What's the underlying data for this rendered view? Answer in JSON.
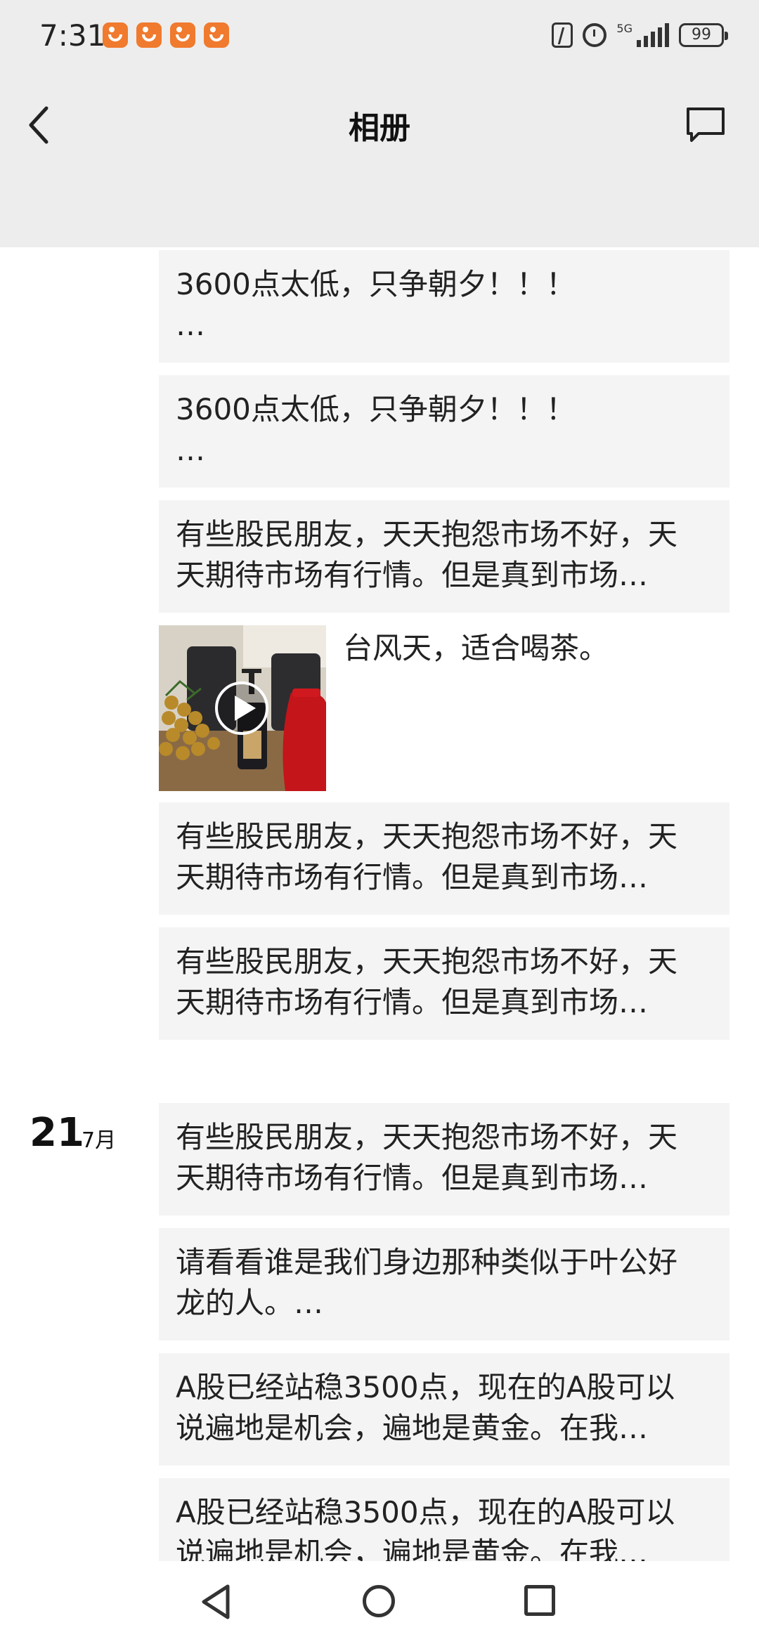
{
  "status_bar": {
    "time": "7:31",
    "notifications": [
      "app-notification-icon",
      "app-notification-icon",
      "app-notification-icon",
      "app-notification-icon"
    ],
    "network": "5G",
    "battery": "99"
  },
  "header": {
    "title": "相册",
    "back_icon": "chevron-left-icon",
    "action_icon": "comment-icon"
  },
  "feed": {
    "posts": [
      {
        "text": "3600点太低，只争朝夕！！！\n…"
      },
      {
        "text": "3600点太低，只争朝夕！！！\n…"
      },
      {
        "text": "有些股民朋友，天天抱怨市场不好，天\n天期待市场有行情。但是真到市场…"
      },
      {
        "type": "video",
        "caption": "台风天，适合喝茶。"
      },
      {
        "text": "有些股民朋友，天天抱怨市场不好，天\n天期待市场有行情。但是真到市场…"
      },
      {
        "text": "有些股民朋友，天天抱怨市场不好，天\n天期待市场有行情。但是真到市场…"
      }
    ],
    "date_group": {
      "day": "21",
      "month": "7月"
    },
    "posts_21": [
      {
        "text": "有些股民朋友，天天抱怨市场不好，天\n天期待市场有行情。但是真到市场…"
      },
      {
        "text": "请看看谁是我们身边那种类似于叶公好\n龙的人。…"
      },
      {
        "text": "A股已经站稳3500点，现在的A股可以\n说遍地是机会，遍地是黄金。在我…"
      },
      {
        "text": "A股已经站稳3500点，现在的A股可以\n说遍地是机会，遍地是黄金。在我…"
      }
    ]
  },
  "nav": {
    "back": "triangle-back-icon",
    "home": "circle-home-icon",
    "recent": "square-recents-icon"
  }
}
